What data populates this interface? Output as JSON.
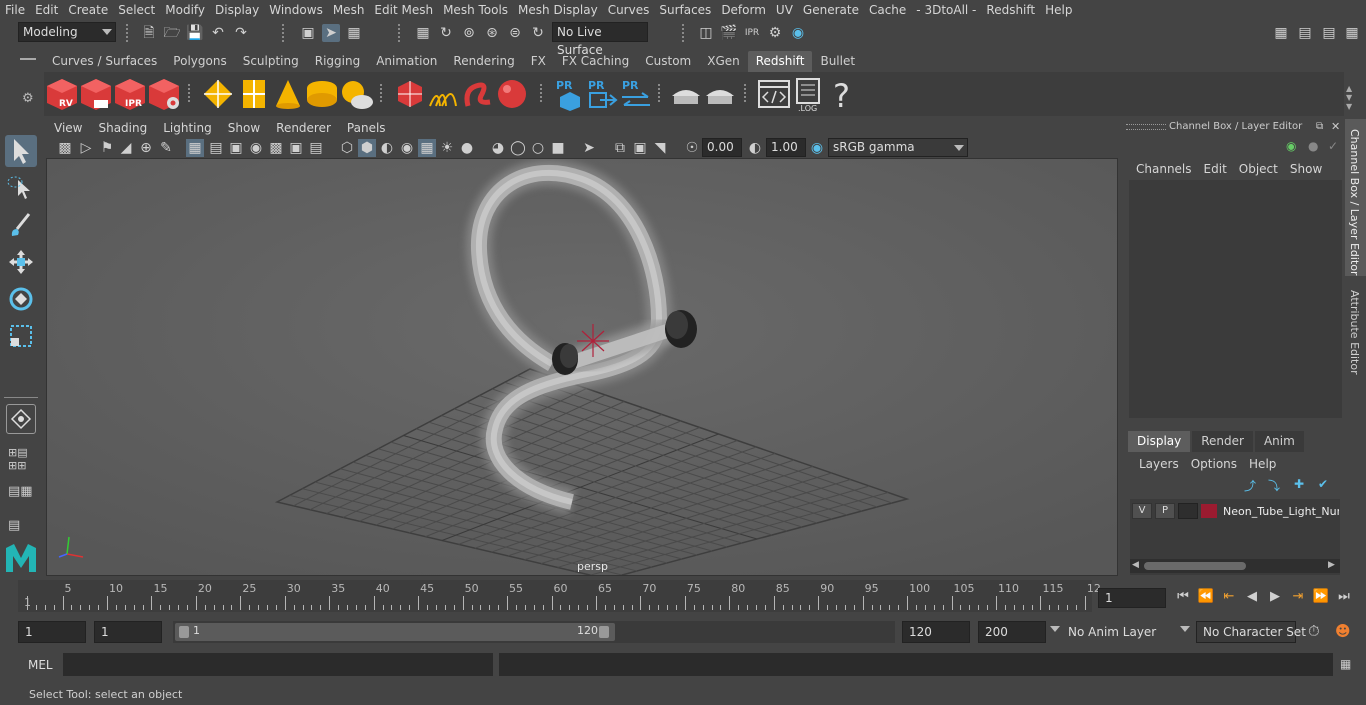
{
  "menubar": [
    "File",
    "Edit",
    "Create",
    "Select",
    "Modify",
    "Display",
    "Windows",
    "Mesh",
    "Edit Mesh",
    "Mesh Tools",
    "Mesh Display",
    "Curves",
    "Surfaces",
    "Deform",
    "UV",
    "Generate",
    "Cache",
    "- 3DtoAll -",
    "Redshift",
    "Help"
  ],
  "status": {
    "mode": "Modeling",
    "live_surface": "No Live Surface"
  },
  "shelf_tabs": [
    "Curves / Surfaces",
    "Polygons",
    "Sculpting",
    "Rigging",
    "Animation",
    "Rendering",
    "FX",
    "FX Caching",
    "Custom",
    "XGen",
    "Redshift",
    "Bullet"
  ],
  "shelf_active": "Redshift",
  "shelf_icon_labels": {
    "rv": "RV",
    "ipr": "IPR",
    "pr": "PR",
    "log": ".LOG",
    "help": "?"
  },
  "viewport": {
    "menu": [
      "View",
      "Shading",
      "Lighting",
      "Show",
      "Renderer",
      "Panels"
    ],
    "exposure": "0.00",
    "gamma": "1.00",
    "color_space": "sRGB gamma",
    "camera_label": "persp"
  },
  "channel_box": {
    "title": "Channel Box / Layer Editor",
    "menu": [
      "Channels",
      "Edit",
      "Object",
      "Show"
    ],
    "layer_tabs": [
      "Display",
      "Render",
      "Anim"
    ],
    "layer_menu": [
      "Layers",
      "Options",
      "Help"
    ],
    "layer": {
      "v": "V",
      "p": "P",
      "name": "Neon_Tube_Light_Nur",
      "color": "#9b1b30"
    },
    "side_tabs": [
      "Channel Box / Layer Editor",
      "Attribute Editor"
    ]
  },
  "timeline": {
    "labels": [
      "5",
      "10",
      "15",
      "20",
      "25",
      "30",
      "35",
      "40",
      "45",
      "50",
      "55",
      "60",
      "65",
      "70",
      "75",
      "80",
      "85",
      "90",
      "95",
      "100",
      "105",
      "110",
      "115",
      "12"
    ],
    "first_frame": "1",
    "current_frame": "1"
  },
  "range": {
    "start": "1",
    "start2": "1",
    "slider_start": "1",
    "slider_end": "120",
    "end": "120",
    "end2": "200",
    "anim_layer": "No Anim Layer",
    "character_set": "No Character Set"
  },
  "command": {
    "lang": "MEL"
  },
  "helpline": "Select Tool: select an object",
  "colors": {
    "accent": "#5d5d5d",
    "redshift_red": "#e03b3b",
    "selection_blue": "#5a6f80",
    "pr_blue": "#3aa0e0",
    "gold": "#f4b400"
  }
}
